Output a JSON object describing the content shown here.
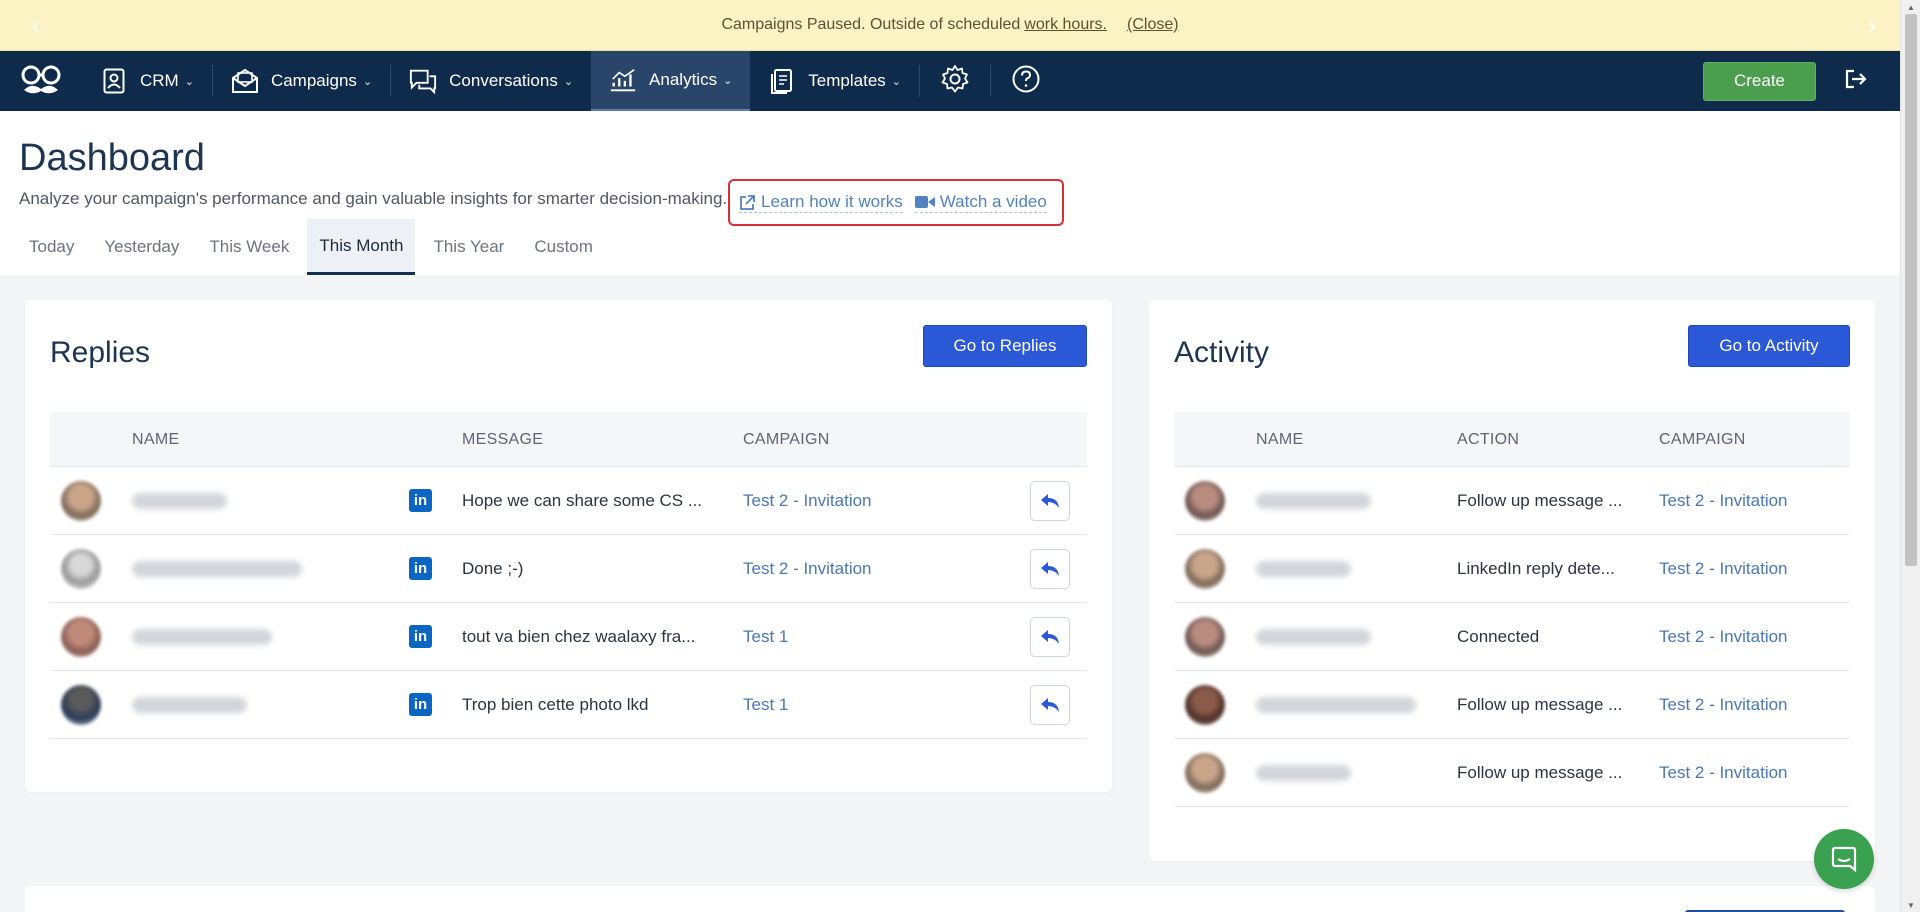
{
  "banner": {
    "text": "Campaigns Paused. Outside of scheduled",
    "link": "work hours.",
    "close": "(Close)"
  },
  "nav": {
    "crm": "CRM",
    "campaigns": "Campaigns",
    "conversations": "Conversations",
    "analytics": "Analytics",
    "templates": "Templates",
    "create": "Create"
  },
  "header": {
    "title": "Dashboard",
    "subtitle": "Analyze your campaign's performance and gain valuable insights for smarter decision-making.",
    "learn_link": "Learn how it works",
    "video_link": "Watch a video"
  },
  "tabs": [
    "Today",
    "Yesterday",
    "This Week",
    "This Month",
    "This Year",
    "Custom"
  ],
  "replies": {
    "title": "Replies",
    "button": "Go to Replies",
    "columns": {
      "name": "NAME",
      "message": "MESSAGE",
      "campaign": "CAMPAIGN"
    },
    "rows": [
      {
        "message": "Hope we can share some CS ...",
        "campaign": "Test 2 - Invitation"
      },
      {
        "message": "Done ;-)",
        "campaign": "Test 2 - Invitation"
      },
      {
        "message": "tout va bien chez waalaxy fra...",
        "campaign": "Test 1"
      },
      {
        "message": "Trop bien cette photo lkd",
        "campaign": "Test 1"
      }
    ]
  },
  "activity": {
    "title": "Activity",
    "button": "Go to Activity",
    "columns": {
      "name": "NAME",
      "action": "ACTION",
      "campaign": "CAMPAIGN"
    },
    "rows": [
      {
        "action": "Follow up message ...",
        "campaign": "Test 2 - Invitation"
      },
      {
        "action": "LinkedIn reply dete...",
        "campaign": "Test 2 - Invitation"
      },
      {
        "action": "Connected",
        "campaign": "Test 2 - Invitation"
      },
      {
        "action": "Follow up message ...",
        "campaign": "Test 2 - Invitation"
      },
      {
        "action": "Follow up message ...",
        "campaign": "Test 2 - Invitation"
      }
    ]
  },
  "colors": {
    "banner_bg": "#fcf3c5",
    "nav_bg": "#0f2b4c",
    "primary_button": "#2b58d6",
    "create_button": "#4a9e4d",
    "link": "#4a78b4",
    "highlight_box": "#d92d3a",
    "linkedin": "#0a66c2"
  }
}
